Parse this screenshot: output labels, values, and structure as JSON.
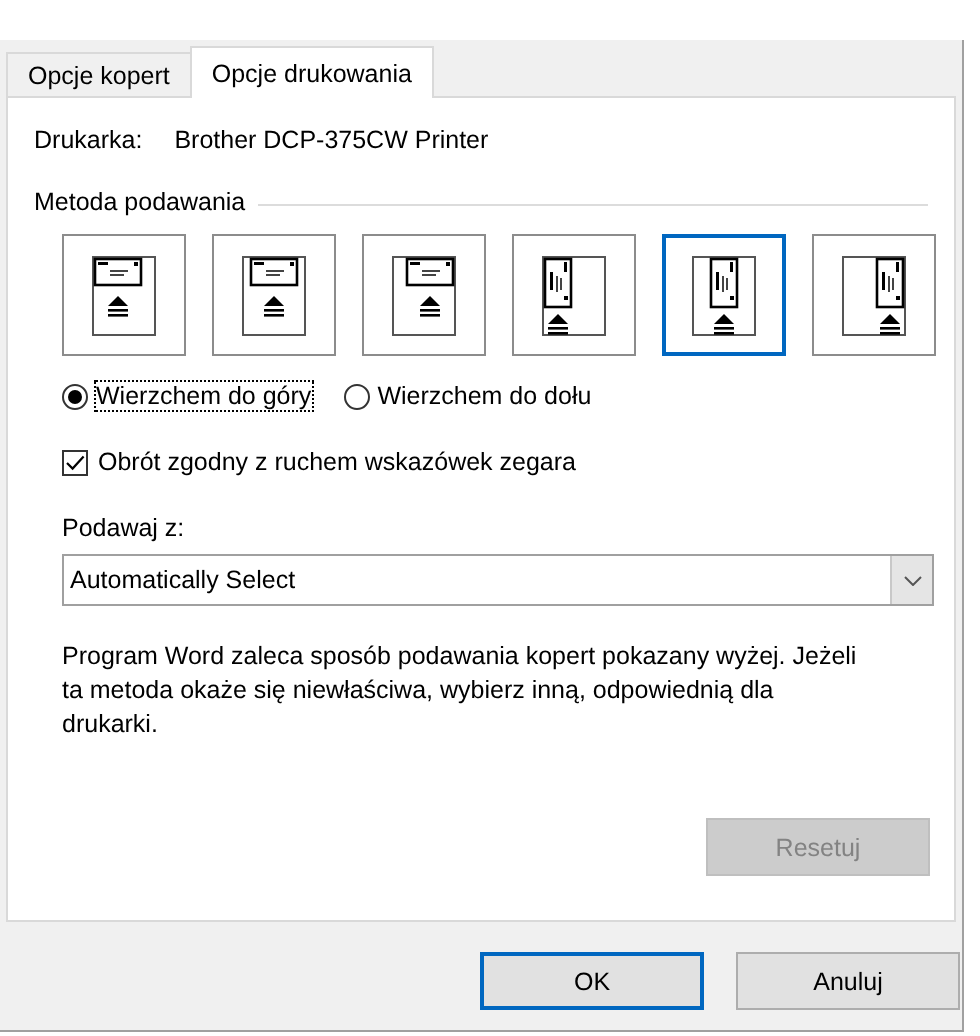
{
  "tabs": [
    {
      "label": "Opcje kopert",
      "selected": false
    },
    {
      "label": "Opcje drukowania",
      "selected": true
    }
  ],
  "printer": {
    "label": "Drukarka:",
    "value": "Brother DCP-375CW Printer"
  },
  "feed_method": {
    "label": "Metoda podawania",
    "options": [
      {
        "kind": "landscape-left",
        "selected": false
      },
      {
        "kind": "landscape-center",
        "selected": false
      },
      {
        "kind": "landscape-right",
        "selected": false
      },
      {
        "kind": "portrait-left",
        "selected": false
      },
      {
        "kind": "portrait-center",
        "selected": true
      },
      {
        "kind": "portrait-right",
        "selected": false
      }
    ]
  },
  "face": [
    {
      "label": "Wierzchem do góry",
      "selected": true
    },
    {
      "label": "Wierzchem do dołu",
      "selected": false
    }
  ],
  "clockwise": {
    "label": "Obrót zgodny z ruchem wskazówek zegara",
    "checked": true
  },
  "feed_from": {
    "label": "Podawaj z:",
    "value": "Automatically Select"
  },
  "note": "Program Word zaleca sposób podawania kopert pokazany wyżej. Jeżeli ta metoda okaże się niewłaściwa, wybierz inną, odpowiednią dla drukarki.",
  "reset_button": {
    "label": "Resetuj",
    "disabled": true
  },
  "buttons": [
    {
      "label": "OK",
      "default": true
    },
    {
      "label": "Anuluj",
      "default": false
    }
  ]
}
